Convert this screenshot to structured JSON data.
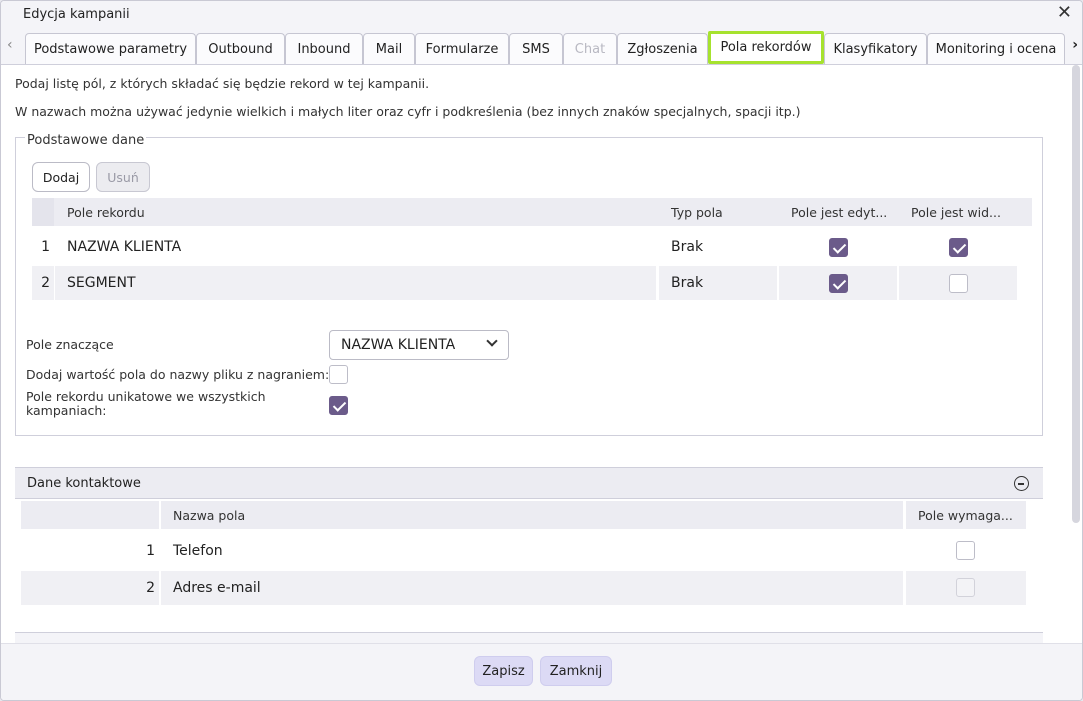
{
  "dialog": {
    "title": "Edycja kampanii"
  },
  "tabs": [
    {
      "label": "Podstawowe parametry",
      "state": "normal"
    },
    {
      "label": "Outbound",
      "state": "normal"
    },
    {
      "label": "Inbound",
      "state": "normal"
    },
    {
      "label": "Mail",
      "state": "normal"
    },
    {
      "label": "Formularze",
      "state": "normal"
    },
    {
      "label": "SMS",
      "state": "normal"
    },
    {
      "label": "Chat",
      "state": "disabled"
    },
    {
      "label": "Zgłoszenia",
      "state": "normal"
    },
    {
      "label": "Pola rekordów",
      "state": "active"
    },
    {
      "label": "Klasyfikatory",
      "state": "normal"
    },
    {
      "label": "Monitoring i ocena",
      "state": "normal"
    }
  ],
  "intro": {
    "line1": "Podaj listę pól, z których składać się będzie rekord w tej kampanii.",
    "line2": "W nazwach można używać jedynie wielkich i małych liter oraz cyfr i podkreślenia (bez innych znaków specjalnych, spacji itp.)"
  },
  "basic": {
    "legend": "Podstawowe dane",
    "add_label": "Dodaj",
    "remove_label": "Usuń",
    "columns": {
      "field": "Pole rekordu",
      "type": "Typ pola",
      "editable": "Pole jest edyt...",
      "visible": "Pole jest wid..."
    },
    "rows": [
      {
        "num": "1",
        "name": "NAZWA KLIENTA",
        "type": "Brak",
        "editable": true,
        "visible": true
      },
      {
        "num": "2",
        "name": "SEGMENT",
        "type": "Brak",
        "editable": true,
        "visible": false
      }
    ],
    "significant_label": "Pole znaczące",
    "significant_value": "NAZWA KLIENTA",
    "append_label": "Dodaj wartość pola do nazwy pliku z nagraniem:",
    "append_checked": false,
    "unique_label": "Pole rekordu unikatowe we wszystkich kampaniach:",
    "unique_checked": true
  },
  "contact": {
    "title": "Dane kontaktowe",
    "columns": {
      "field": "Nazwa pola",
      "required": "Pole wymaga..."
    },
    "rows": [
      {
        "num": "1",
        "name": "Telefon",
        "required": false
      },
      {
        "num": "2",
        "name": "Adres e-mail",
        "required": false
      }
    ]
  },
  "footer": {
    "save_label": "Zapisz",
    "close_label": "Zamknij"
  },
  "colors": {
    "accent": "#6b5b8a",
    "active_tab_border": "#a6e22e",
    "footer_button": "#dcdaf5"
  },
  "icons": {
    "close": "close-icon",
    "tab_left": "chevron-left-icon",
    "tab_right": "chevron-right-icon",
    "select": "chevron-down-icon",
    "collapse": "minus-circle-icon"
  }
}
